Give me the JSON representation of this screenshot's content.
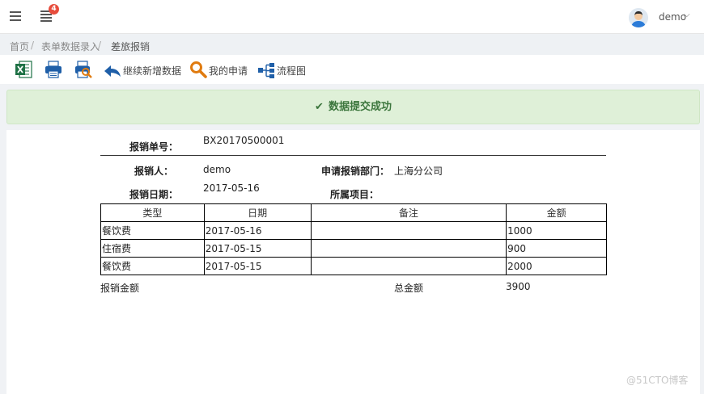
{
  "topbar": {
    "notification_count": "4",
    "user_name": "demo",
    "user_caret": "⌵"
  },
  "breadcrumb": {
    "items": [
      "首页",
      "表单数据录入",
      "差旅报销"
    ],
    "separator": "/"
  },
  "toolbar": {
    "continue_add_label": "继续新增数据",
    "my_requests_label": "我的申请",
    "flowchart_label": "流程图"
  },
  "alert": {
    "message": "数据提交成功",
    "color": "#3c763d"
  },
  "form": {
    "voucher_no_label": "报销单号：",
    "voucher_no": "BX20170500001",
    "claimant_label": "报销人：",
    "claimant": "demo",
    "department_label": "申请报销部门：",
    "department": "上海分公司",
    "date_label": "报销日期：",
    "date": "2017-05-16",
    "project_label": "所属项目：",
    "project": ""
  },
  "table": {
    "headers": [
      "类型",
      "日期",
      "备注",
      "金额"
    ],
    "rows": [
      [
        "餐饮费",
        "2017-05-16",
        "",
        "1000"
      ],
      [
        "住宿费",
        "2017-05-15",
        "",
        "900"
      ],
      [
        "餐饮费",
        "2017-05-15",
        "",
        "2000"
      ]
    ]
  },
  "summary": {
    "amount_label": "报销金额",
    "total_label": "总金额",
    "total": "3900"
  },
  "watermark": "@51CTO博客",
  "icons": {
    "menu": "hamburger-icon",
    "messages": "message-list-icon",
    "excel": "excel-icon",
    "print": "printer-icon",
    "print_preview": "print-preview-icon",
    "back": "back-arrow-icon",
    "search": "magnifier-icon",
    "flow": "flowchart-icon"
  }
}
